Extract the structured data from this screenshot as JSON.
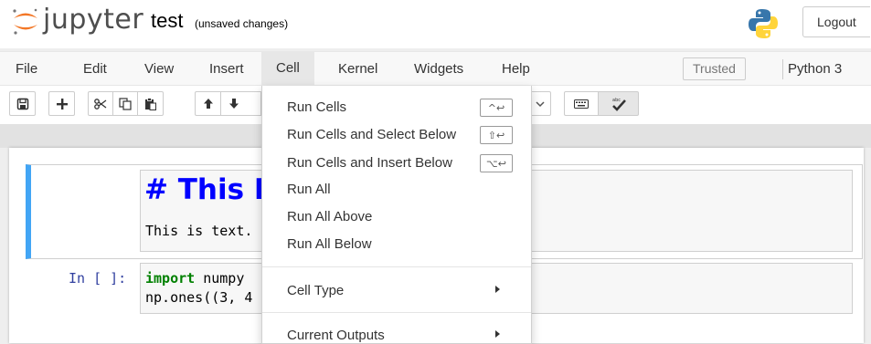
{
  "header": {
    "app_name": "jupyter",
    "notebook_title": "test",
    "save_status": "(unsaved changes)",
    "logout_label": "Logout"
  },
  "menubar": {
    "items": [
      "File",
      "Edit",
      "View",
      "Insert",
      "Cell",
      "Kernel",
      "Widgets",
      "Help"
    ],
    "active": "Cell",
    "trusted_label": "Trusted",
    "kernel_name": "Python 3"
  },
  "toolbar": {
    "icons": [
      "save-icon",
      "plus-icon",
      "scissors-icon",
      "copy-icon",
      "paste-icon",
      "arrow-up-icon",
      "arrow-down-icon",
      "keyboard-icon",
      "checkmark-icon"
    ]
  },
  "cell_menu": {
    "run_cells": "Run Cells",
    "run_cells_select_below": "Run Cells and Select Below",
    "run_cells_insert_below": "Run Cells and Insert Below",
    "run_all": "Run All",
    "run_all_above": "Run All Above",
    "run_all_below": "Run All Below",
    "cell_type": "Cell Type",
    "current_outputs": "Current Outputs",
    "shortcuts": [
      "^↩",
      "⇧↩",
      "⌥↩"
    ]
  },
  "notebook": {
    "markdown_heading": "# This Is",
    "markdown_text": "This is text.",
    "code_prompt": "In [ ]:",
    "code_line1_kw": "import",
    "code_line1_rest": " numpy",
    "code_line2": "np.ones((3, 4"
  },
  "colors": {
    "selected_cell_border": "#42a5f5",
    "heading": "#0000ff",
    "prompt": "#303f9f",
    "keyword": "#008000"
  }
}
